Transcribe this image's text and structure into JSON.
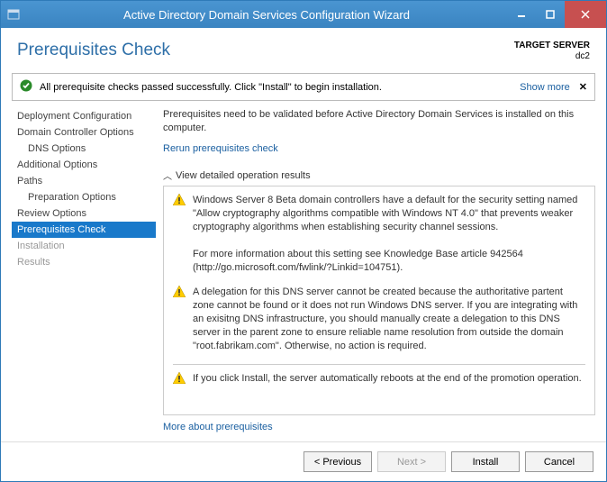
{
  "titlebar": {
    "title": "Active Directory Domain Services Configuration Wizard"
  },
  "header": {
    "title": "Prerequisites Check",
    "server_label": "TARGET SERVER",
    "server_name": "dc2"
  },
  "status": {
    "message": "All prerequisite checks passed successfully. Click \"Install\" to begin installation.",
    "show_more": "Show more"
  },
  "sidebar": {
    "items": [
      {
        "label": "Deployment Configuration",
        "indent": false
      },
      {
        "label": "Domain Controller Options",
        "indent": false
      },
      {
        "label": "DNS Options",
        "indent": true
      },
      {
        "label": "Additional Options",
        "indent": false
      },
      {
        "label": "Paths",
        "indent": false
      },
      {
        "label": "Preparation Options",
        "indent": true
      },
      {
        "label": "Review Options",
        "indent": false
      },
      {
        "label": "Prerequisites Check",
        "indent": false,
        "active": true
      },
      {
        "label": "Installation",
        "indent": false,
        "disabled": true
      },
      {
        "label": "Results",
        "indent": false,
        "disabled": true
      }
    ]
  },
  "main": {
    "intro": "Prerequisites need to be validated before Active Directory Domain Services is installed on this computer.",
    "rerun": "Rerun prerequisites check",
    "results_header": "View detailed operation results",
    "notes": [
      "Windows Server 8 Beta domain controllers have a default for the security setting named \"Allow cryptography algorithms compatible with Windows NT 4.0\" that prevents weaker cryptography algorithms when establishing security channel sessions.\n\nFor more information about this setting see Knowledge Base article 942564 (http://go.microsoft.com/fwlink/?Linkid=104751).",
      "A delegation for this DNS server cannot be created because the authoritative partent zone cannot be found or it does not run Windows DNS server. If you are integrating with an exisitng DNS infrastructure, you should manually create a delegation to this DNS server in the parent zone to ensure reliable name resolution from outside the domain \"root.fabrikam.com\". Otherwise, no action is required.",
      "If you click Install, the server automatically reboots at the end of the promotion operation."
    ],
    "more": "More about prerequisites"
  },
  "footer": {
    "previous": "< Previous",
    "next": "Next >",
    "install": "Install",
    "cancel": "Cancel"
  }
}
